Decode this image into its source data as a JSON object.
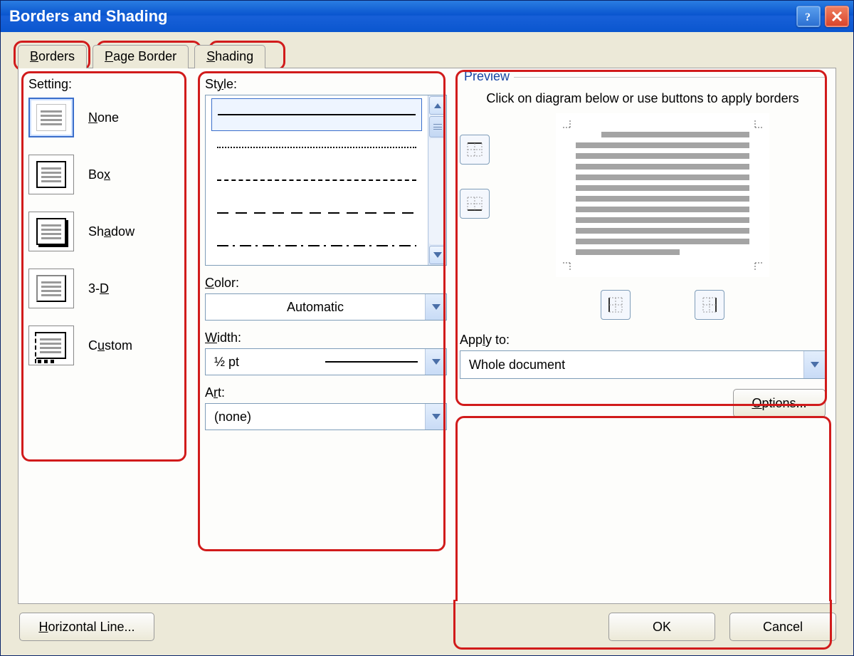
{
  "title": "Borders and Shading",
  "tabs": {
    "borders": "Borders",
    "page_border": "Page Border",
    "shading": "Shading"
  },
  "setting": {
    "label": "Setting:",
    "none": "None",
    "box": "Box",
    "shadow": "Shadow",
    "threeD": "3-D",
    "custom": "Custom"
  },
  "style": {
    "label": "Style:"
  },
  "color": {
    "label": "Color:",
    "value": "Automatic"
  },
  "width": {
    "label": "Width:",
    "value": "½ pt"
  },
  "art": {
    "label": "Art:",
    "value": "(none)"
  },
  "preview": {
    "label": "Preview",
    "help": "Click on diagram below or use buttons to apply borders"
  },
  "apply": {
    "label": "Apply to:",
    "value": "Whole document"
  },
  "buttons": {
    "options": "Options...",
    "hline": "Horizontal Line...",
    "ok": "OK",
    "cancel": "Cancel"
  }
}
